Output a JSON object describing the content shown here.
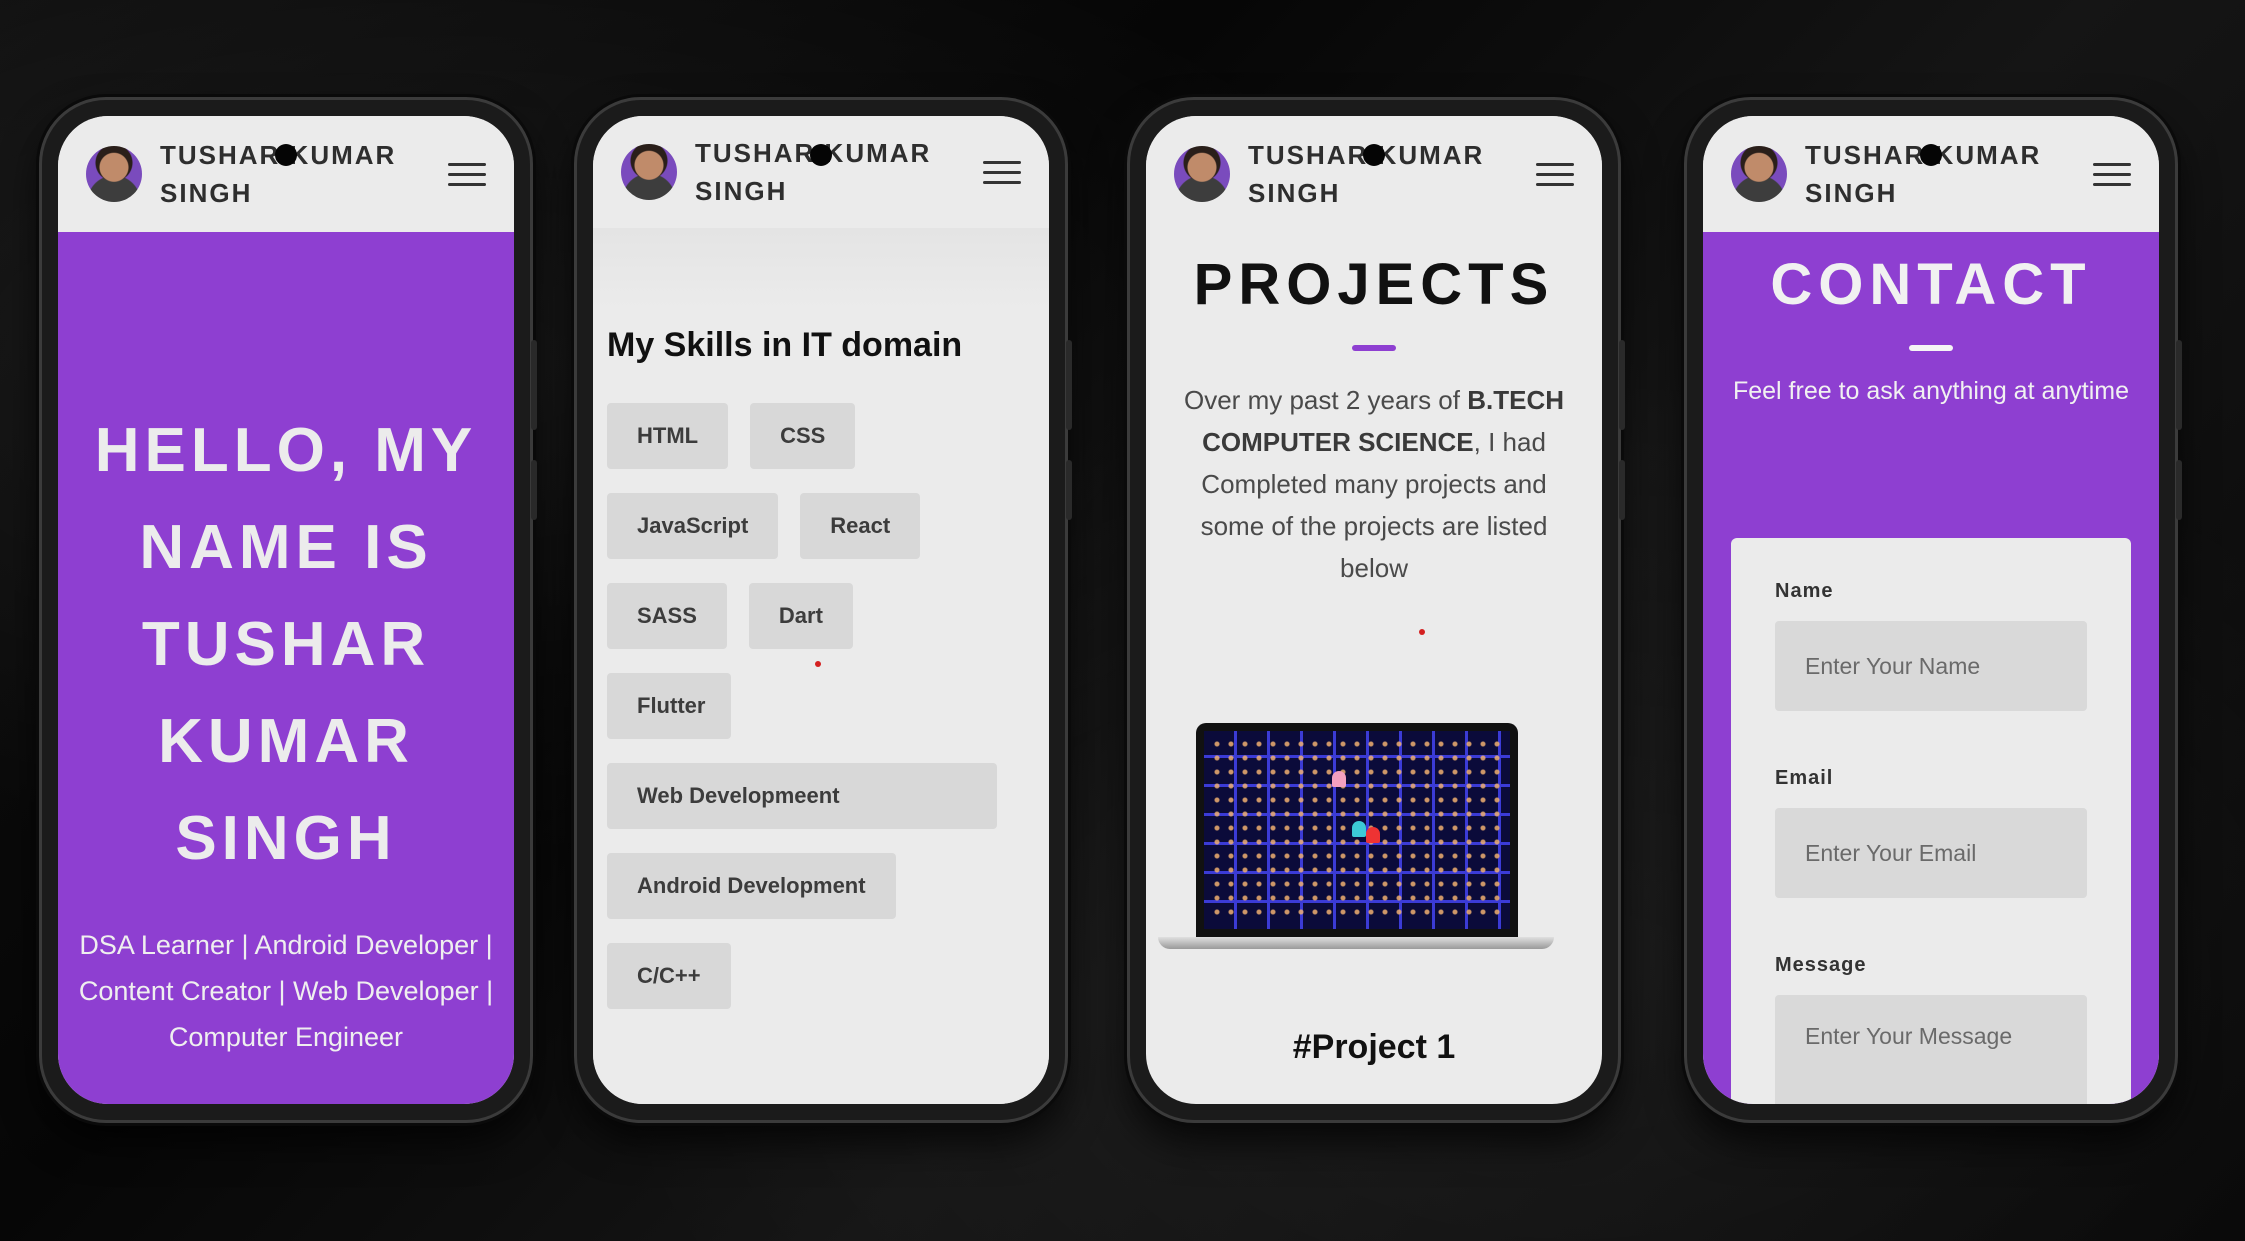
{
  "brand": {
    "name_line1": "TUSHAR KUMAR",
    "name_line2": "SINGH"
  },
  "colors": {
    "accent": "#8e3fd1",
    "light_bg": "#ebebeb",
    "chip_bg": "#d8d8d8"
  },
  "icons": {
    "avatar": "profile-photo",
    "menu": "hamburger-menu-icon"
  },
  "home": {
    "greeting_lines": [
      "HELLO, MY",
      "NAME IS",
      "TUSHAR",
      "KUMAR",
      "SINGH"
    ],
    "tagline": "DSA Learner | Android Developer | Content Creator | Web Developer | Computer Engineer"
  },
  "skills": {
    "heading": "My Skills in IT domain",
    "items": [
      "HTML",
      "CSS",
      "JavaScript",
      "React",
      "SASS",
      "Dart",
      "Flutter",
      "Web Developmeent",
      "Android Development",
      "C/C++"
    ]
  },
  "projects": {
    "title": "PROJECTS",
    "desc_prefix": "Over my past 2 years of ",
    "desc_bold": "B.TECH COMPUTER SCIENCE",
    "desc_suffix": ", I had Completed many projects and some of the projects are listed below",
    "project_name": "#Project 1"
  },
  "contact": {
    "title": "CONTACT",
    "subtitle": "Feel free to ask anything at anytime",
    "name_label": "Name",
    "name_placeholder": "Enter Your Name",
    "email_label": "Email",
    "email_placeholder": "Enter Your Email",
    "message_label": "Message",
    "message_placeholder": "Enter Your Message"
  }
}
